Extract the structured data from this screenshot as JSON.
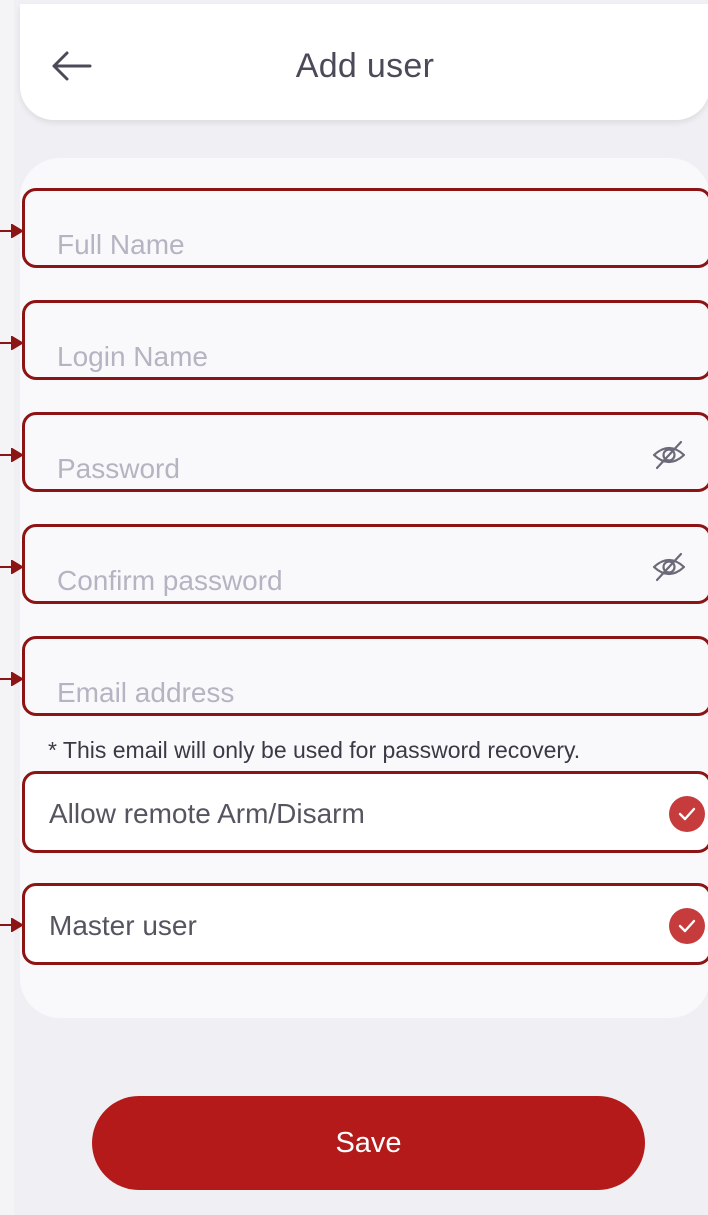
{
  "header": {
    "title": "Add user",
    "back_icon": "arrow-left-icon"
  },
  "form": {
    "full_name": {
      "placeholder": "Full Name",
      "value": ""
    },
    "login_name": {
      "placeholder": "Login Name",
      "value": ""
    },
    "password": {
      "placeholder": "Password",
      "value": "",
      "icon": "eye-off-icon"
    },
    "confirm_password": {
      "placeholder": "Confirm password",
      "value": "",
      "icon": "eye-off-icon"
    },
    "email": {
      "placeholder": "Email address",
      "value": ""
    },
    "email_note": "* This email will only be used for password recovery."
  },
  "options": [
    {
      "label": "Allow remote Arm/Disarm",
      "checked": true
    },
    {
      "label": "Master user",
      "checked": true
    }
  ],
  "save_label": "Save",
  "colors": {
    "accent": "#b41a1a",
    "check": "#c63c3c",
    "highlight_border": "#8c1414",
    "background": "#f0f0f4"
  }
}
